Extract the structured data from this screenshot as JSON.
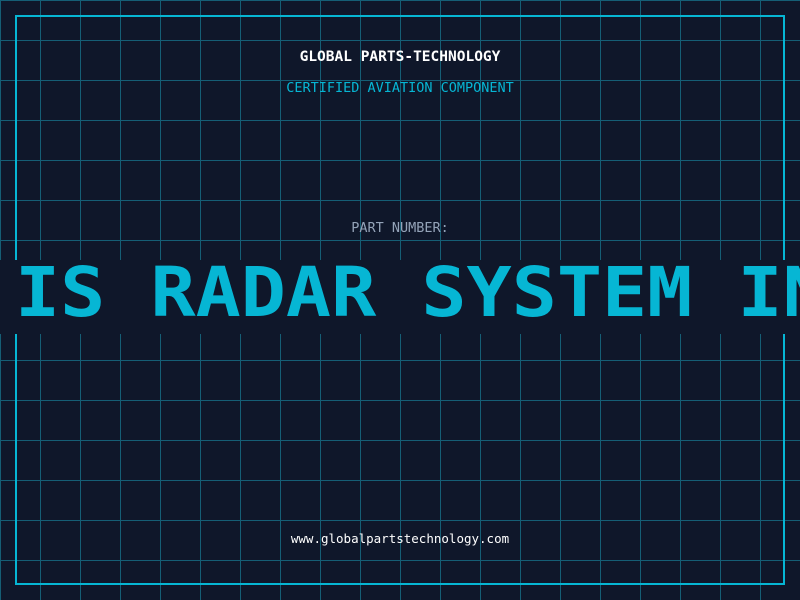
{
  "header": {
    "title": "GLOBAL PARTS-TECHNOLOGY",
    "subtitle": "CERTIFIED AVIATION COMPONENT"
  },
  "part": {
    "label": "PART NUMBER:",
    "value_visible": "IS RADAR SYSTEM IN"
  },
  "footer": {
    "url": "www.globalpartstechnology.com"
  },
  "colors": {
    "background": "#0f172a",
    "accent": "#06b6d4",
    "grid": "#155e75",
    "label": "#94a3b8"
  }
}
